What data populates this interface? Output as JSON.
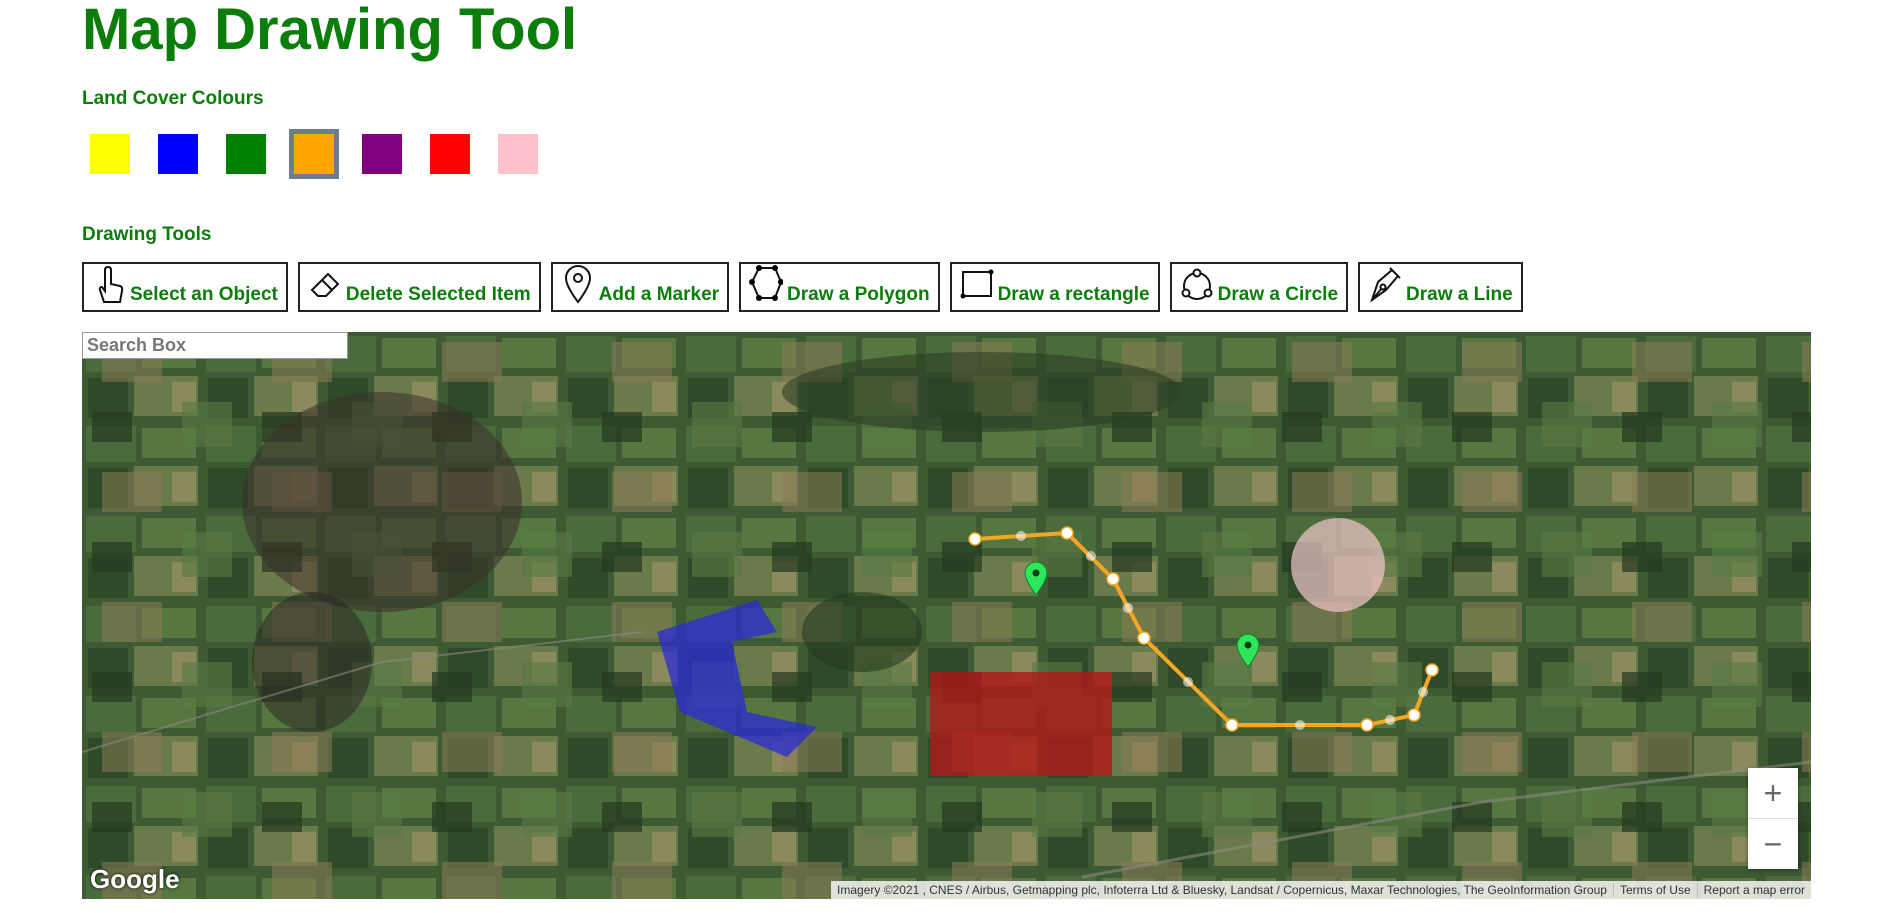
{
  "page": {
    "title": "Map Drawing Tool",
    "land_cover_label": "Land Cover Colours",
    "drawing_tools_label": "Drawing Tools"
  },
  "colours": [
    {
      "name": "yellow",
      "hex": "#ffff00",
      "selected": false
    },
    {
      "name": "blue",
      "hex": "#0000ff",
      "selected": false
    },
    {
      "name": "green",
      "hex": "#008000",
      "selected": false
    },
    {
      "name": "orange",
      "hex": "#ffa500",
      "selected": true
    },
    {
      "name": "purple",
      "hex": "#800080",
      "selected": false
    },
    {
      "name": "red",
      "hex": "#ff0000",
      "selected": false
    },
    {
      "name": "pink",
      "hex": "#ffc0cb",
      "selected": false
    }
  ],
  "tools": [
    {
      "label": "Select an Object",
      "icon": "hand-pointer-icon"
    },
    {
      "label": "Delete Selected Item",
      "icon": "eraser-icon"
    },
    {
      "label": "Add a Marker",
      "icon": "map-pin-icon"
    },
    {
      "label": "Draw a Polygon",
      "icon": "polygon-icon"
    },
    {
      "label": "Draw a rectangle",
      "icon": "rectangle-icon"
    },
    {
      "label": "Draw a Circle",
      "icon": "circle-icon"
    },
    {
      "label": "Draw a Line",
      "icon": "pen-nib-icon"
    }
  ],
  "search": {
    "placeholder": "Search Box"
  },
  "map": {
    "zoom_in": "+",
    "zoom_out": "−",
    "logo": "Google",
    "attribution": "Imagery ©2021 , CNES / Airbus, Getmapping plc, Infoterra Ltd & Bluesky, Landsat / Copernicus, Maxar Technologies, The GeoInformation Group",
    "terms": "Terms of Use",
    "report": "Report a map error",
    "overlay_colours": {
      "polygon": "#2b2bd6",
      "rectangle": "#b01818",
      "circle": "#f2c6cc",
      "line": "#f5a623",
      "marker": "#2ee65a"
    }
  }
}
